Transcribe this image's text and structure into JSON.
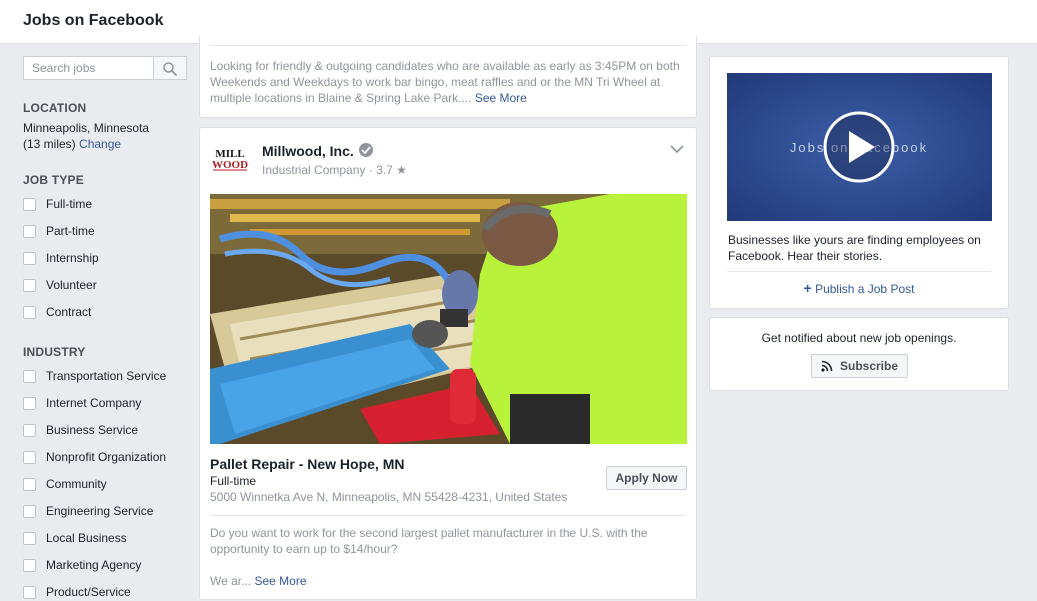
{
  "header": {
    "title": "Jobs on Facebook"
  },
  "search": {
    "placeholder": "Search jobs"
  },
  "location": {
    "heading": "LOCATION",
    "city": "Minneapolis, Minnesota",
    "radius": "(13 miles)",
    "change_label": "Change"
  },
  "job_type": {
    "heading": "JOB TYPE",
    "options": [
      "Full-time",
      "Part-time",
      "Internship",
      "Volunteer",
      "Contract"
    ]
  },
  "industry": {
    "heading": "INDUSTRY",
    "options": [
      "Transportation Service",
      "Internet Company",
      "Business Service",
      "Nonprofit Organization",
      "Community",
      "Engineering Service",
      "Local Business",
      "Marketing Agency",
      "Product/Service"
    ]
  },
  "prev_post": {
    "description": "Looking for friendly & outgoing candidates who are available as early as 3:45PM on both Weekends and Weekdays to work bar bingo, meat raffles and or the MN Tri Wheel at multiple locations in Blaine & Spring Lake Park....",
    "see_more": "See More"
  },
  "post": {
    "company": "Millwood, Inc.",
    "category": "Industrial Company",
    "rating": "3.7",
    "logo_text_top": "MILL",
    "logo_text_bottom": "WOOD",
    "job_title": "Pallet Repair - New Hope, MN",
    "job_type": "Full-time",
    "address": "5000 Winnetka Ave N, Minneapolis, MN 55428-4231, United States",
    "apply_label": "Apply Now",
    "description": "Do you want to work for the second largest pallet manufacturer in the U.S. with the opportunity to earn up to $14/hour?",
    "teaser": "We ar...",
    "see_more": "See More"
  },
  "promo": {
    "video_text": "Jobs on Facebook",
    "text": "Businesses like yours are finding employees on Facebook. Hear their stories.",
    "publish_label": "Publish a Job Post"
  },
  "notify": {
    "text": "Get notified about new job openings.",
    "subscribe_label": "Subscribe"
  },
  "colors": {
    "link": "#365899",
    "video_bg": "#2f4a8f",
    "shirt": "#b8f23a",
    "pallet_blue": "#3a8fd1"
  },
  "icons": [
    "search-icon",
    "verified-icon",
    "star-icon",
    "chevron-down-icon",
    "play-icon",
    "plus-icon",
    "rss-icon"
  ]
}
